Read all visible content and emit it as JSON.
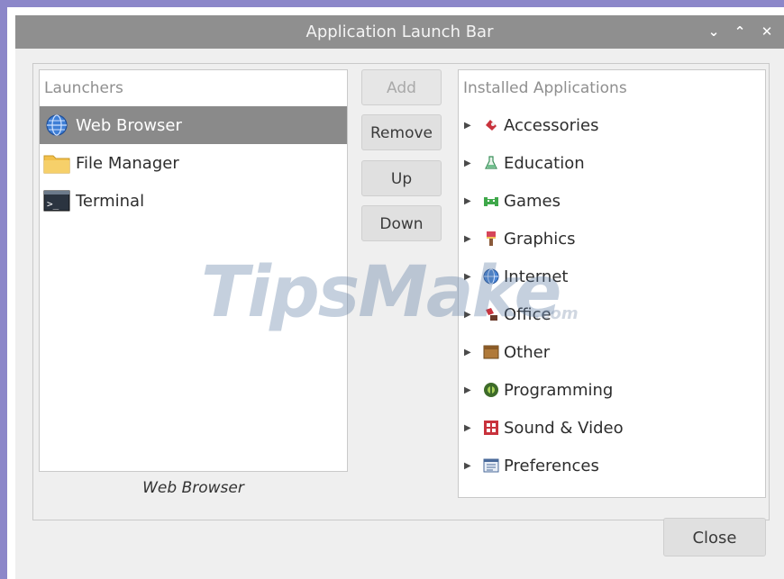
{
  "window": {
    "title": "Application Launch Bar",
    "controls": {
      "minimize": "⌄",
      "maximize": "⌃",
      "close": "✕"
    }
  },
  "launchers": {
    "header": "Launchers",
    "items": [
      {
        "label": "Web Browser",
        "icon": "globe-icon",
        "selected": true
      },
      {
        "label": "File Manager",
        "icon": "folder-icon",
        "selected": false
      },
      {
        "label": "Terminal",
        "icon": "terminal-icon",
        "selected": false
      }
    ],
    "caption": "Web Browser"
  },
  "buttons": {
    "add": "Add",
    "remove": "Remove",
    "up": "Up",
    "down": "Down",
    "close": "Close"
  },
  "installed": {
    "header": "Installed Applications",
    "categories": [
      {
        "label": "Accessories",
        "icon": "accessories-icon"
      },
      {
        "label": "Education",
        "icon": "education-icon"
      },
      {
        "label": "Games",
        "icon": "games-icon"
      },
      {
        "label": "Graphics",
        "icon": "graphics-icon"
      },
      {
        "label": "Internet",
        "icon": "internet-icon"
      },
      {
        "label": "Office",
        "icon": "office-icon"
      },
      {
        "label": "Other",
        "icon": "other-icon"
      },
      {
        "label": "Programming",
        "icon": "programming-icon"
      },
      {
        "label": "Sound & Video",
        "icon": "sound-video-icon"
      },
      {
        "label": "Preferences",
        "icon": "preferences-icon"
      }
    ]
  },
  "watermark": {
    "main": "TipsMake",
    "sub": ".com"
  },
  "colors": {
    "titlebar": "#8f8f8f",
    "selection": "#8a8a8a",
    "frame_accent": "#8c87c9"
  }
}
